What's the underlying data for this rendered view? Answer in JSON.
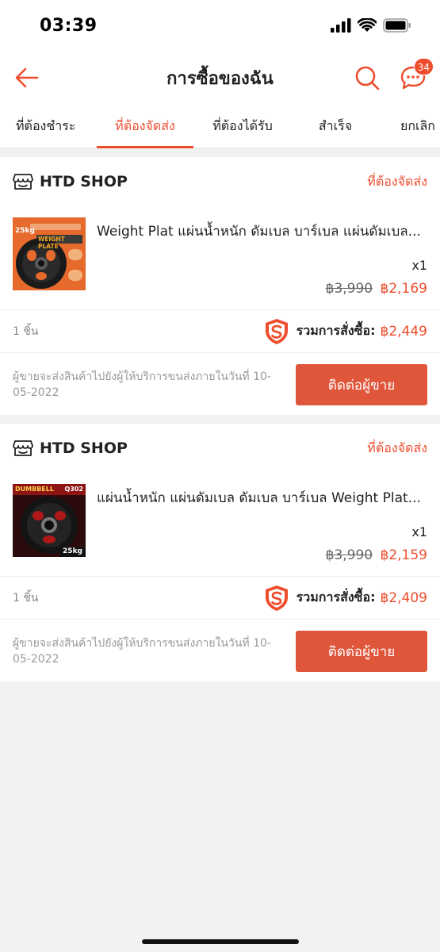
{
  "status_bar": {
    "time": "03:39"
  },
  "header": {
    "title": "การซื้อของฉัน",
    "chat_badge": "34"
  },
  "tabs": [
    {
      "label": "ที่ต้องชำระ"
    },
    {
      "label": "ที่ต้องจัดส่ง"
    },
    {
      "label": "ที่ต้องได้รับ"
    },
    {
      "label": "สำเร็จ"
    },
    {
      "label": "ยกเลิก"
    }
  ],
  "orders": [
    {
      "shop_name": "HTD SHOP",
      "status": "ที่ต้องจัดส่ง",
      "product_name": "Weight Plat แผ่นน้ำหนัก ดัมเบล บาร์เบล แผ่นดัมเบล...",
      "quantity": "x1",
      "old_price": "฿3,990",
      "new_price": "฿2,169",
      "item_count": "1 ชิ้น",
      "total_label": "รวมการสั่งซื้อ:",
      "total_value": "฿2,449",
      "ship_note": "ผู้ขายจะส่งสินค้าไปยังผู้ให้บริการขนส่งภายในวันที่ 10-05-2022",
      "contact_label": "ติดต่อผู้ขาย",
      "thumb_text_top": "25kg",
      "thumb_text_banner": "WEIGHT PLATE"
    },
    {
      "shop_name": "HTD SHOP",
      "status": "ที่ต้องจัดส่ง",
      "product_name": "แผ่นน้ำหนัก  แผ่นดัมเบล ดัมเบล บาร์เบล Weight Plat...",
      "quantity": "x1",
      "old_price": "฿3,990",
      "new_price": "฿2,159",
      "item_count": "1 ชิ้น",
      "total_label": "รวมการสั่งซื้อ:",
      "total_value": "฿2,409",
      "ship_note": "ผู้ขายจะส่งสินค้าไปยังผู้ให้บริการขนส่งภายในวันที่ 10-05-2022",
      "contact_label": "ติดต่อผู้ขาย",
      "thumb_text_top": "DUMBBELL",
      "thumb_text_code": "Q302",
      "thumb_text_weight": "25kg"
    }
  ],
  "colors": {
    "accent": "#ee4d2d",
    "button": "#e0563b",
    "background": "#f2f2f2"
  }
}
